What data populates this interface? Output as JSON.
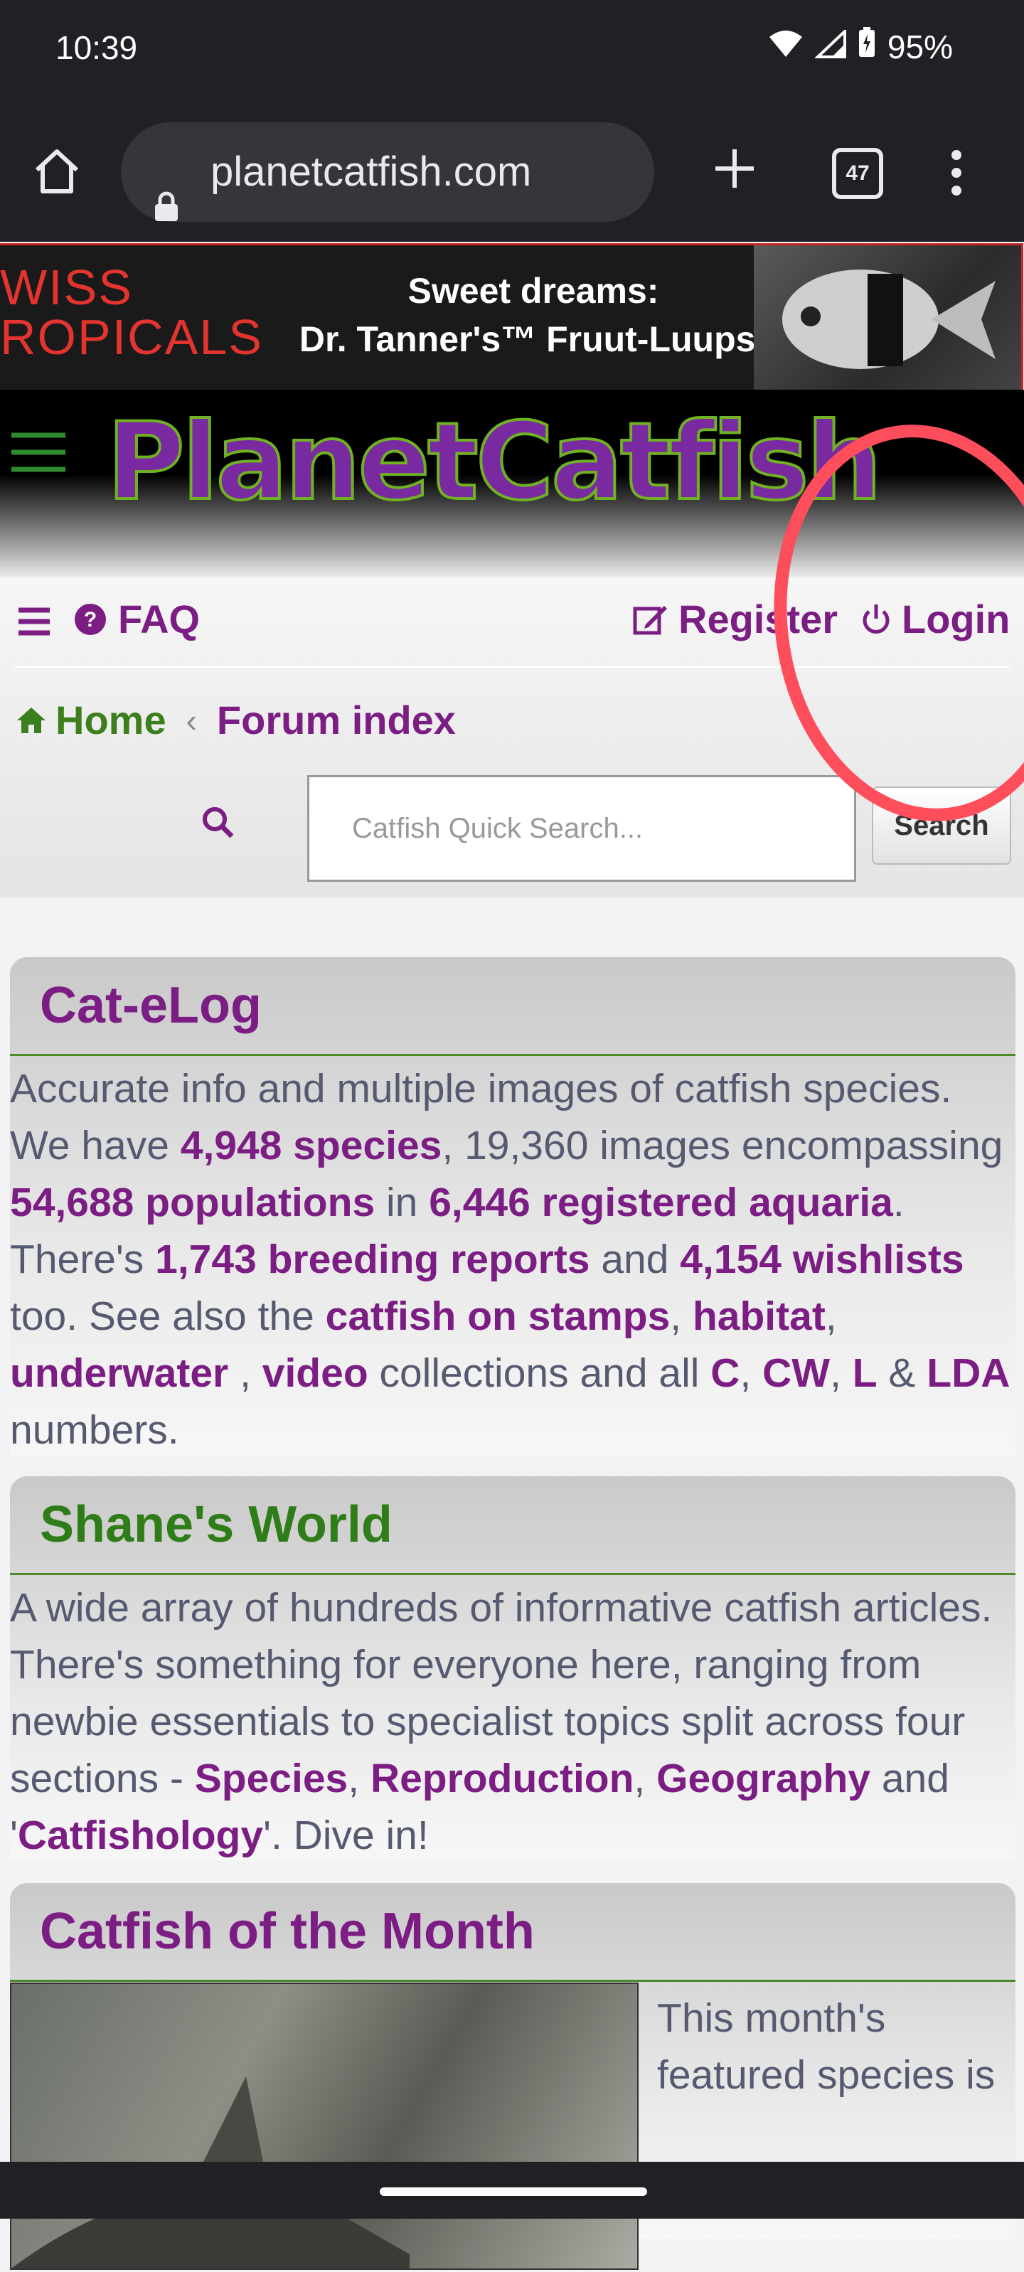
{
  "status_bar": {
    "time": "10:39",
    "battery": "95%"
  },
  "browser": {
    "url": "planetcatfish.com",
    "tab_count": "47"
  },
  "ad": {
    "brand_line1": "WISS",
    "brand_line2": "ROPICALS",
    "tagline1": "Sweet dreams:",
    "tagline2": "Dr. Tanner's™ Fruut-Luups!"
  },
  "header": {
    "logo_text": "PlanetCatfish"
  },
  "nav": {
    "faq": "FAQ",
    "register": "Register",
    "login": "Login",
    "breadcrumb_home": "Home",
    "breadcrumb_sep": "‹",
    "breadcrumb_forum": "Forum index",
    "search_placeholder": "Catfish Quick Search...",
    "search_button": "Search"
  },
  "panels": {
    "catelog": {
      "title": "Cat-eLog",
      "t1": "Accurate info and multiple images of catfish species. We have ",
      "species": "4,948 species",
      "t2": ", 19,360 images encompassing ",
      "populations": "54,688 populations",
      "t3": " in ",
      "aquaria": "6,446 registered aquaria",
      "t4": ". There's ",
      "breeding": "1,743 breeding reports",
      "t5": " and ",
      "wishlists": "4,154 wishlists",
      "t6": " too. See also the ",
      "stamps": "catfish on stamps",
      "c1": ", ",
      "habitat": "habitat",
      "c2": ", ",
      "underwater": "underwater",
      "c3": " , ",
      "video": "video",
      "t7": " collections and all ",
      "c_num": "C",
      "c4": ", ",
      "cw_num": "CW",
      "c5": ", ",
      "l_num": "L",
      "amp": " & ",
      "lda_num": "LDA",
      "t8": " numbers."
    },
    "shanes_world": {
      "title": "Shane's World",
      "t1": "A wide array of hundreds of informative catfish articles. There's something for everyone here, ranging from newbie essentials to specialist topics split across four sections - ",
      "species": "Species",
      "c1": ", ",
      "reproduction": "Reproduction",
      "c2": ", ",
      "geography": "Geography",
      "t2": " and '",
      "catfishology": "Catfishology",
      "t3": "'. Dive in!"
    },
    "cotm": {
      "title": "Catfish of the Month",
      "text": "This month's featured species is"
    }
  },
  "colors": {
    "brand_purple": "#7b1d83",
    "brand_green": "#2f7d18",
    "annotation_red": "#ff4e5b"
  }
}
